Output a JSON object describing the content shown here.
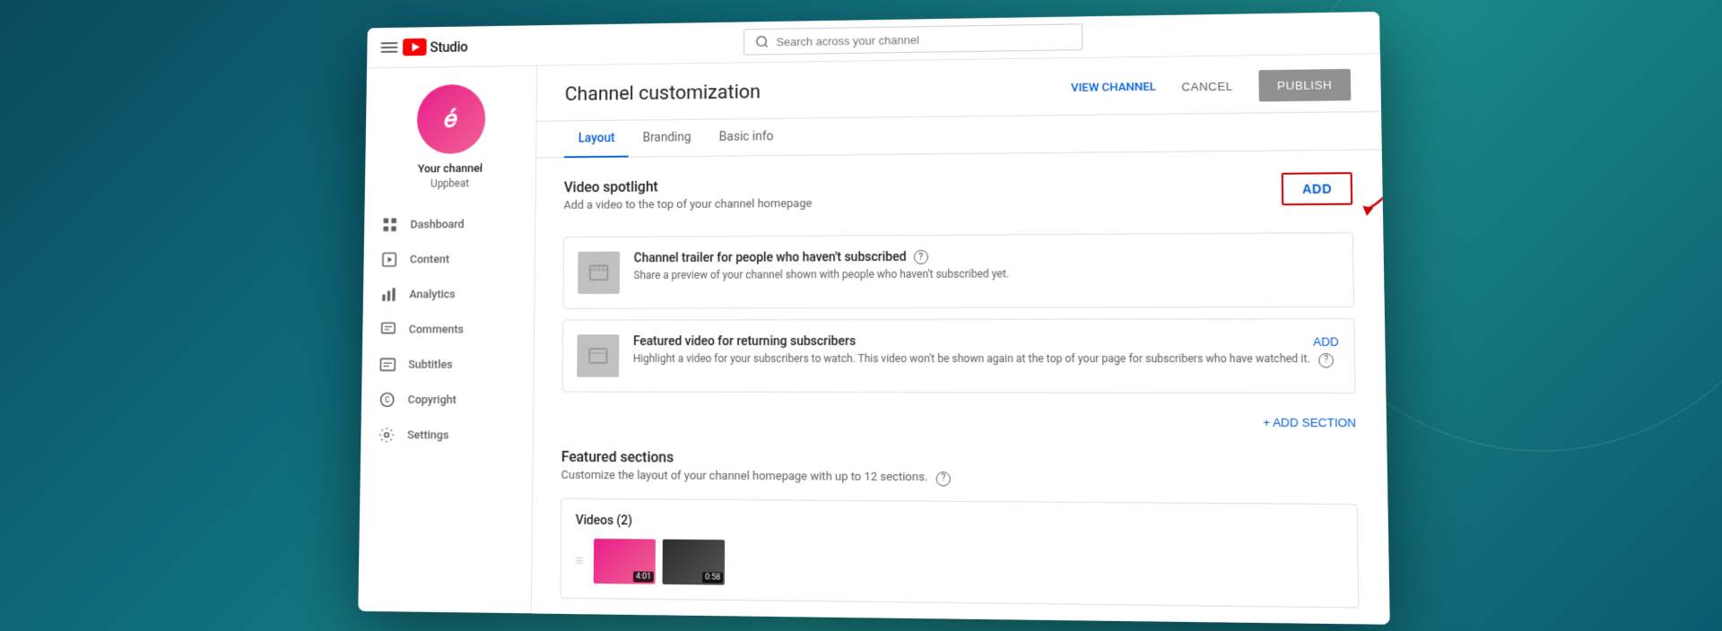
{
  "app": {
    "name": "Studio",
    "search_placeholder": "Search across your channel"
  },
  "sidebar": {
    "channel_name": "Your channel",
    "channel_handle": "Uppbeat",
    "avatar_text": "e",
    "items": [
      {
        "id": "dashboard",
        "label": "Dashboard",
        "icon": "dashboard"
      },
      {
        "id": "content",
        "label": "Content",
        "icon": "content"
      },
      {
        "id": "analytics",
        "label": "Analytics",
        "icon": "analytics"
      },
      {
        "id": "comments",
        "label": "Comments",
        "icon": "comments"
      },
      {
        "id": "subtitles",
        "label": "Subtitles",
        "icon": "subtitles"
      },
      {
        "id": "copyright",
        "label": "Copyright",
        "icon": "copyright"
      },
      {
        "id": "settings",
        "label": "Settings",
        "icon": "settings"
      }
    ]
  },
  "header": {
    "title": "Channel customization",
    "view_channel": "VIEW CHANNEL",
    "cancel": "CANCEL",
    "publish": "PUBLISH"
  },
  "tabs": [
    {
      "id": "layout",
      "label": "Layout",
      "active": true
    },
    {
      "id": "branding",
      "label": "Branding",
      "active": false
    },
    {
      "id": "basic-info",
      "label": "Basic info",
      "active": false
    }
  ],
  "video_spotlight": {
    "title": "Video spotlight",
    "desc": "Add a video to the top of your channel homepage",
    "add_btn": "ADD",
    "cards": [
      {
        "id": "trailer",
        "title": "Channel trailer for people who haven't subscribed",
        "desc": "Share a preview of your channel shown with people who haven't subscribed yet.",
        "has_help": true
      },
      {
        "id": "featured",
        "title": "Featured video for returning subscribers",
        "desc": "Highlight a video for your subscribers to watch. This video won't be shown again at the top of your page for subscribers who have watched it.",
        "has_help": true,
        "add_label": "ADD"
      }
    ]
  },
  "add_section": {
    "label": "+ ADD SECTION"
  },
  "featured_sections": {
    "title": "Featured sections",
    "desc": "Customize the layout of your channel homepage with up to 12 sections.",
    "has_help": true,
    "section_card": {
      "title": "Videos (2)",
      "thumbs": [
        {
          "duration": "4:01",
          "style": "pink"
        },
        {
          "duration": "0:58",
          "style": "dark"
        }
      ]
    }
  }
}
